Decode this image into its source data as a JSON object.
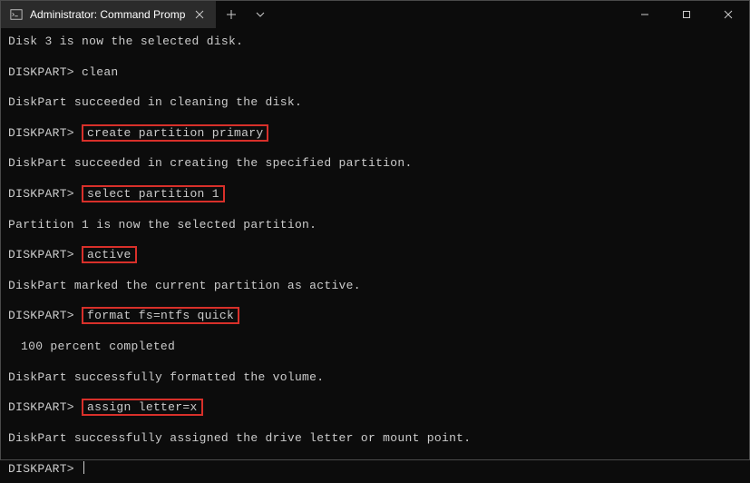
{
  "window": {
    "tab_title": "Administrator: Command Promp"
  },
  "terminal": {
    "prompt": "DISKPART>",
    "lines": {
      "l1": "Disk 3 is now the selected disk.",
      "cmd_clean": "clean",
      "l2": "DiskPart succeeded in cleaning the disk.",
      "cmd_create": "create partition primary",
      "l3": "DiskPart succeeded in creating the specified partition.",
      "cmd_select": "select partition 1",
      "l4": "Partition 1 is now the selected partition.",
      "cmd_active": "active",
      "l5": "DiskPart marked the current partition as active.",
      "cmd_format": "format fs=ntfs quick",
      "l6": "100 percent completed",
      "l7": "DiskPart successfully formatted the volume.",
      "cmd_assign": "assign letter=x",
      "l8": "DiskPart successfully assigned the drive letter or mount point."
    }
  }
}
